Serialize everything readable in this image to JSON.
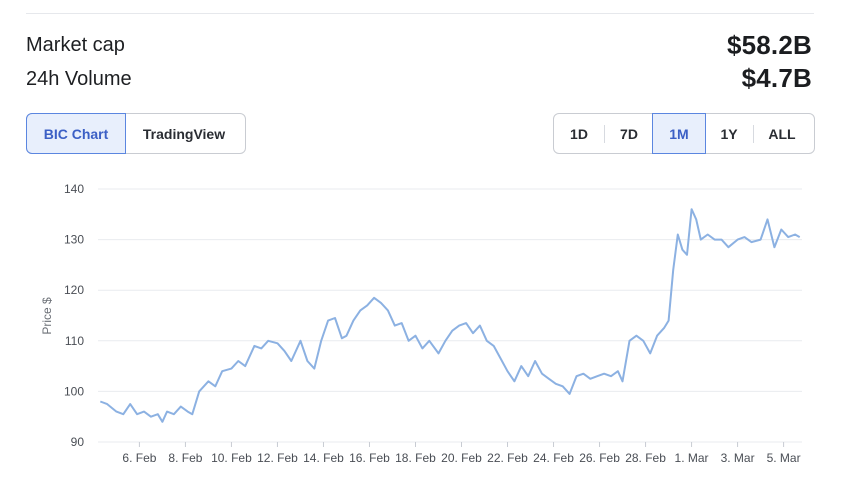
{
  "stats": {
    "market_cap_label": "Market cap",
    "market_cap_value": "$58.2B",
    "volume_label": "24h Volume",
    "volume_value": "$4.7B"
  },
  "chart_type_tabs": [
    {
      "label": "BIC Chart",
      "active": true
    },
    {
      "label": "TradingView",
      "active": false
    }
  ],
  "range_tabs": [
    {
      "label": "1D",
      "active": false
    },
    {
      "label": "7D",
      "active": false
    },
    {
      "label": "1M",
      "active": true
    },
    {
      "label": "1Y",
      "active": false
    },
    {
      "label": "ALL",
      "active": false
    }
  ],
  "colors": {
    "line": "#8cb1e2",
    "grid": "#e9ebef",
    "accent": "#3b5fc5"
  },
  "chart_data": {
    "type": "line",
    "title": "",
    "xlabel": "",
    "ylabel": "Price $",
    "ylim": [
      90,
      140
    ],
    "yticks": [
      90,
      100,
      110,
      120,
      130,
      140
    ],
    "x_ticks": [
      {
        "label": "6. Feb",
        "x": 6
      },
      {
        "label": "8. Feb",
        "x": 8
      },
      {
        "label": "10. Feb",
        "x": 10
      },
      {
        "label": "12. Feb",
        "x": 12
      },
      {
        "label": "14. Feb",
        "x": 14
      },
      {
        "label": "16. Feb",
        "x": 16
      },
      {
        "label": "18. Feb",
        "x": 18
      },
      {
        "label": "20. Feb",
        "x": 20
      },
      {
        "label": "22. Feb",
        "x": 22
      },
      {
        "label": "24. Feb",
        "x": 24
      },
      {
        "label": "26. Feb",
        "x": 26
      },
      {
        "label": "28. Feb",
        "x": 28
      },
      {
        "label": "1. Mar",
        "x": 30
      },
      {
        "label": "3. Mar",
        "x": 32
      },
      {
        "label": "5. Mar",
        "x": 34
      }
    ],
    "xlim": [
      4.2,
      34.8
    ],
    "grid": "horizontal",
    "series": [
      {
        "x": [
          4.3,
          4.6,
          5.0,
          5.3,
          5.6,
          5.9,
          6.2,
          6.5,
          6.8,
          7.0,
          7.2,
          7.5,
          7.8,
          8.1,
          8.3,
          8.6,
          9.0,
          9.3,
          9.6,
          10.0,
          10.3,
          10.6,
          11.0,
          11.3,
          11.6,
          12.0,
          12.3,
          12.6,
          13.0,
          13.3,
          13.6,
          13.9,
          14.2,
          14.5,
          14.8,
          15.0,
          15.3,
          15.6,
          15.9,
          16.2,
          16.5,
          16.8,
          17.1,
          17.4,
          17.7,
          18.0,
          18.3,
          18.6,
          19.0,
          19.3,
          19.6,
          19.9,
          20.2,
          20.5,
          20.8,
          21.1,
          21.4,
          21.7,
          22.0,
          22.3,
          22.6,
          22.9,
          23.2,
          23.5,
          23.8,
          24.1,
          24.4,
          24.7,
          25.0,
          25.3,
          25.6,
          25.9,
          26.2,
          26.5,
          26.8,
          27.0,
          27.3,
          27.6,
          27.9,
          28.2,
          28.5,
          28.8,
          29.0,
          29.2,
          29.4,
          29.6,
          29.8,
          30.0,
          30.2,
          30.4,
          30.7,
          31.0,
          31.3,
          31.6,
          32.0,
          32.3,
          32.6,
          33.0,
          33.3,
          33.6,
          33.9,
          34.2,
          34.5,
          34.7
        ],
        "y": [
          98,
          97.5,
          96,
          95.5,
          97.5,
          95.5,
          96,
          95,
          95.5,
          94,
          96,
          95.5,
          97,
          96,
          95.5,
          100,
          102,
          101,
          104,
          104.5,
          106,
          105,
          109,
          108.5,
          110,
          109.5,
          108,
          106,
          110,
          106,
          104.5,
          110,
          114,
          114.5,
          110.5,
          111,
          114,
          116,
          117,
          118.5,
          117.5,
          116,
          113,
          113.5,
          110,
          111,
          108.5,
          110,
          107.5,
          110,
          112,
          113,
          113.5,
          111.5,
          113,
          110,
          109,
          106.5,
          104,
          102,
          105,
          103,
          106,
          103.5,
          102.5,
          101.5,
          101,
          99.5,
          103,
          103.5,
          102.5,
          103,
          103.5,
          103,
          104,
          102,
          110,
          111,
          110,
          107.5,
          111,
          112.5,
          114,
          124,
          131,
          128,
          127,
          136,
          134,
          130,
          131,
          130,
          130,
          128.5,
          130,
          130.5,
          129.5,
          130,
          134,
          128.5,
          132,
          130.5,
          131,
          130.5
        ]
      }
    ]
  }
}
